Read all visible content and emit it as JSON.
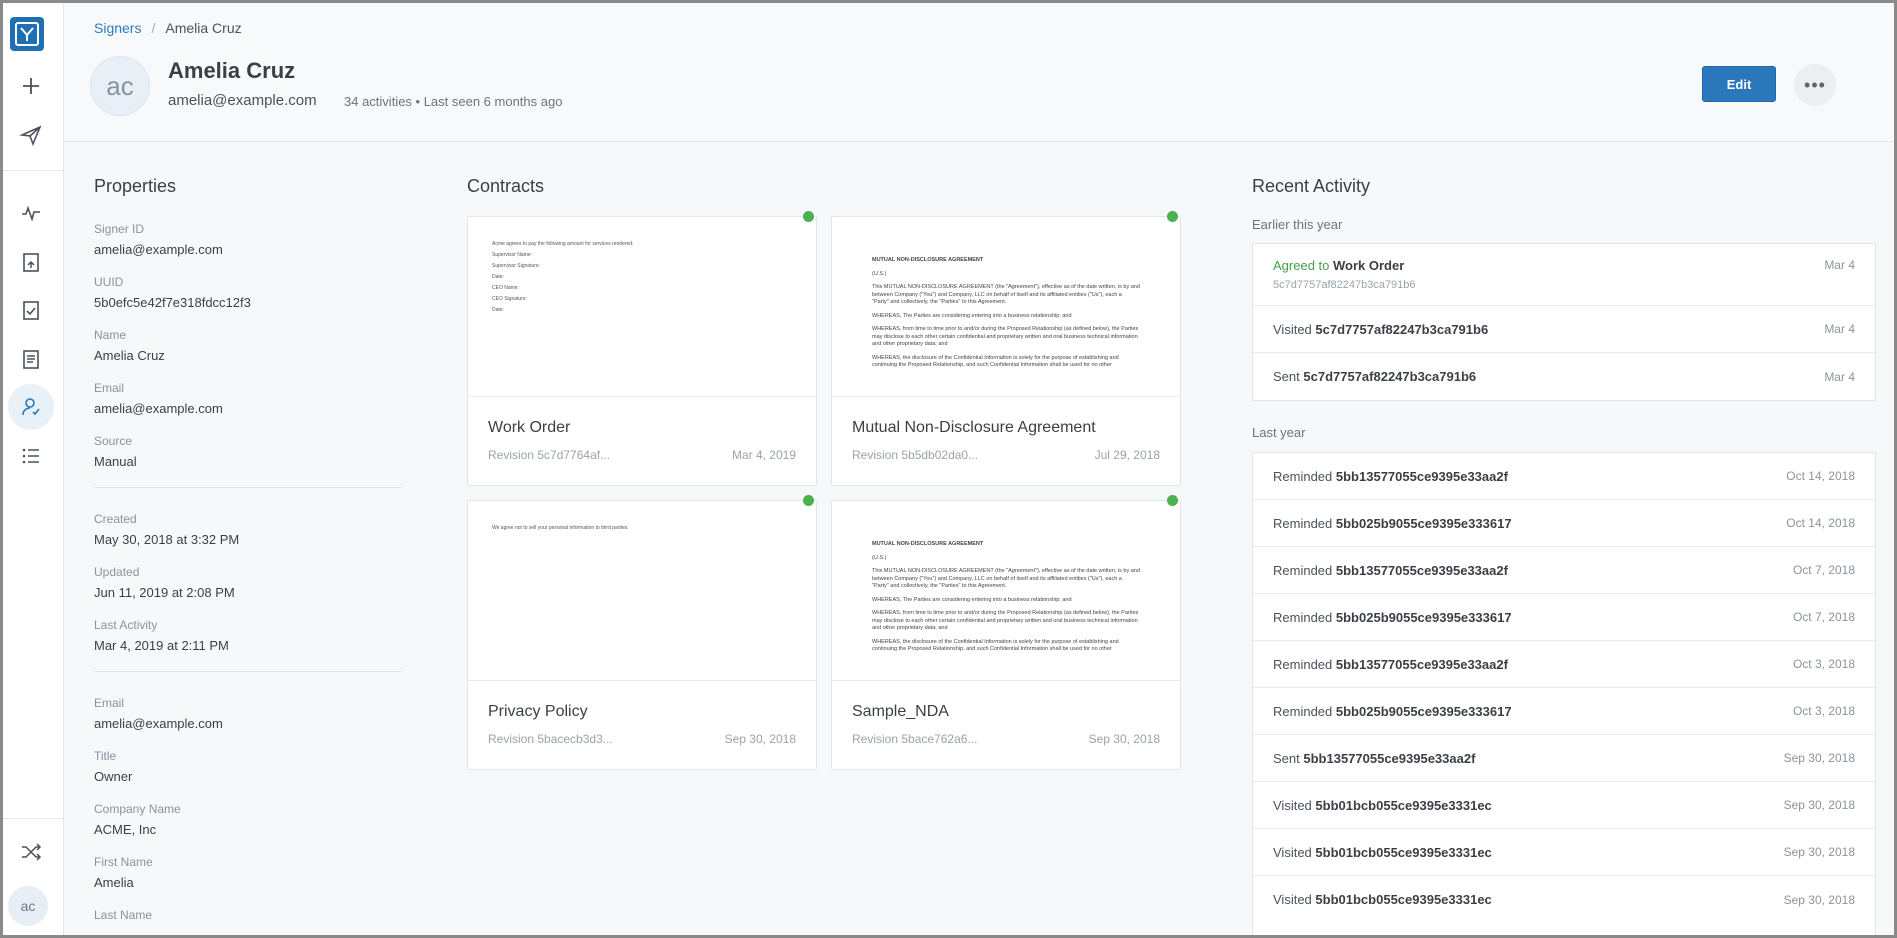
{
  "breadcrumb": {
    "parent": "Signers",
    "current": "Amelia Cruz"
  },
  "profile": {
    "initials": "ac",
    "name": "Amelia Cruz",
    "email": "amelia@example.com",
    "meta": "34 activities  •  Last seen 6 months ago"
  },
  "actions": {
    "edit": "Edit",
    "more": "•••"
  },
  "sidebar": {
    "avatar": "ac"
  },
  "properties": {
    "title": "Properties",
    "group1": [
      {
        "label": "Signer ID",
        "value": "amelia@example.com"
      },
      {
        "label": "UUID",
        "value": "5b0efc5e42f7e318fdcc12f3"
      },
      {
        "label": "Name",
        "value": "Amelia Cruz"
      },
      {
        "label": "Email",
        "value": "amelia@example.com"
      },
      {
        "label": "Source",
        "value": "Manual"
      }
    ],
    "group2": [
      {
        "label": "Created",
        "value": "May 30, 2018 at 3:32 PM"
      },
      {
        "label": "Updated",
        "value": "Jun 11, 2019 at 2:08 PM"
      },
      {
        "label": "Last Activity",
        "value": "Mar 4, 2019 at 2:11 PM"
      }
    ],
    "group3": [
      {
        "label": "Email",
        "value": "amelia@example.com"
      },
      {
        "label": "Title",
        "value": "Owner"
      },
      {
        "label": "Company Name",
        "value": "ACME, Inc"
      },
      {
        "label": "First Name",
        "value": "Amelia"
      },
      {
        "label": "Last Name",
        "value": ""
      }
    ]
  },
  "contracts": {
    "title": "Contracts",
    "items": [
      {
        "title": "Work Order",
        "revision": "Revision 5c7d7764af...",
        "date": "Mar 4, 2019"
      },
      {
        "title": "Mutual Non-Disclosure Agreement",
        "revision": "Revision 5b5db02da0...",
        "date": "Jul 29, 2018"
      },
      {
        "title": "Privacy Policy",
        "revision": "Revision 5bacecb3d3...",
        "date": "Sep 30, 2018"
      },
      {
        "title": "Sample_NDA",
        "revision": "Revision 5bace762a6...",
        "date": "Sep 30, 2018"
      }
    ],
    "work_order_preview": [
      "Acme agrees to pay the following amount for services rendered:",
      "Supervisor Name:",
      "Supervisor Signature:",
      "Date:",
      "CEO Name:",
      "CEO Signature:",
      "Date:"
    ],
    "privacy_preview": "We agree not to sell your personal information to third parties.",
    "nda_preview": {
      "heading": "MUTUAL NON-DISCLOSURE AGREEMENT",
      "sub": "(U.S.)",
      "p1": "This MUTUAL NON-DISCLOSURE AGREEMENT (the \"Agreement\"), effective as of the date written, is by and between Company (\"You\") and Company, LLC on behalf of itself and its affiliated entities (\"Us\"), each a \"Party\" and collectively, the \"Parties\" to this Agreement.",
      "p2": "WHEREAS, The Parties are considering entering into a business relationship; and",
      "p3": "WHEREAS, from time to time prior to and/or during the Proposed Relationship (as defined below), the Parties may disclose to each other certain confidential and proprietary written and oral business technical information and other proprietary data; and",
      "p4": "WHEREAS, the disclosure of the Confidential Information is solely for the purpose of establishing and continuing the Proposed Relationship, and such Confidential Information shall be used for no other"
    }
  },
  "activity": {
    "title": "Recent Activity",
    "earlier_label": "Earlier this year",
    "earlier": [
      {
        "action": "Agreed to",
        "target": "Work Order",
        "sub": "5c7d7757af82247b3ca791b6",
        "date": "Mar 4"
      },
      {
        "action": "Visited",
        "target": "5c7d7757af82247b3ca791b6",
        "date": "Mar 4"
      },
      {
        "action": "Sent",
        "target": "5c7d7757af82247b3ca791b6",
        "date": "Mar 4"
      }
    ],
    "last_label": "Last year",
    "last": [
      {
        "action": "Reminded",
        "target": "5bb13577055ce9395e33aa2f",
        "date": "Oct 14, 2018"
      },
      {
        "action": "Reminded",
        "target": "5bb025b9055ce9395e333617",
        "date": "Oct 14, 2018"
      },
      {
        "action": "Reminded",
        "target": "5bb13577055ce9395e33aa2f",
        "date": "Oct 7, 2018"
      },
      {
        "action": "Reminded",
        "target": "5bb025b9055ce9395e333617",
        "date": "Oct 7, 2018"
      },
      {
        "action": "Reminded",
        "target": "5bb13577055ce9395e33aa2f",
        "date": "Oct 3, 2018"
      },
      {
        "action": "Reminded",
        "target": "5bb025b9055ce9395e333617",
        "date": "Oct 3, 2018"
      },
      {
        "action": "Sent",
        "target": "5bb13577055ce9395e33aa2f",
        "date": "Sep 30, 2018"
      },
      {
        "action": "Visited",
        "target": "5bb01bcb055ce9395e3331ec",
        "date": "Sep 30, 2018"
      },
      {
        "action": "Visited",
        "target": "5bb01bcb055ce9395e3331ec",
        "date": "Sep 30, 2018"
      },
      {
        "action": "Visited",
        "target": "5bb01bcb055ce9395e3331ec",
        "date": "Sep 30, 2018"
      }
    ]
  }
}
